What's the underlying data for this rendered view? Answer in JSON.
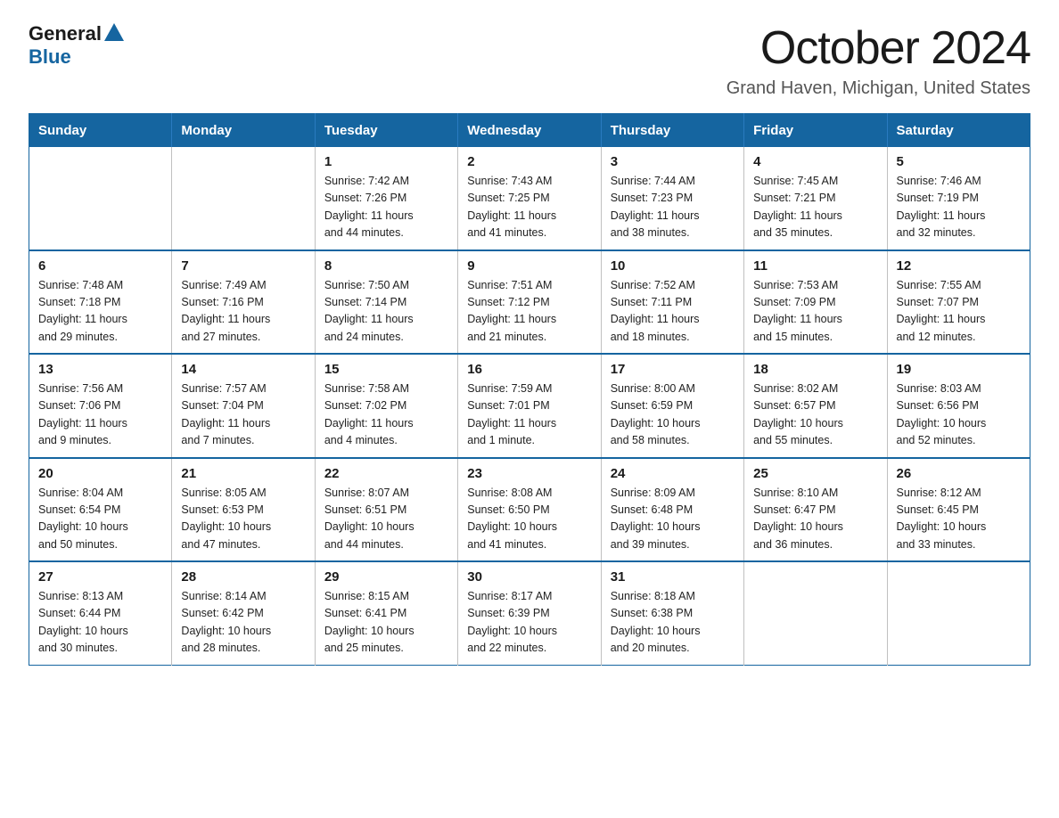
{
  "header": {
    "logo_general": "General",
    "logo_blue": "Blue",
    "title": "October 2024",
    "subtitle": "Grand Haven, Michigan, United States"
  },
  "days_of_week": [
    "Sunday",
    "Monday",
    "Tuesday",
    "Wednesday",
    "Thursday",
    "Friday",
    "Saturday"
  ],
  "weeks": [
    [
      {
        "day": "",
        "info": ""
      },
      {
        "day": "",
        "info": ""
      },
      {
        "day": "1",
        "info": "Sunrise: 7:42 AM\nSunset: 7:26 PM\nDaylight: 11 hours\nand 44 minutes."
      },
      {
        "day": "2",
        "info": "Sunrise: 7:43 AM\nSunset: 7:25 PM\nDaylight: 11 hours\nand 41 minutes."
      },
      {
        "day": "3",
        "info": "Sunrise: 7:44 AM\nSunset: 7:23 PM\nDaylight: 11 hours\nand 38 minutes."
      },
      {
        "day": "4",
        "info": "Sunrise: 7:45 AM\nSunset: 7:21 PM\nDaylight: 11 hours\nand 35 minutes."
      },
      {
        "day": "5",
        "info": "Sunrise: 7:46 AM\nSunset: 7:19 PM\nDaylight: 11 hours\nand 32 minutes."
      }
    ],
    [
      {
        "day": "6",
        "info": "Sunrise: 7:48 AM\nSunset: 7:18 PM\nDaylight: 11 hours\nand 29 minutes."
      },
      {
        "day": "7",
        "info": "Sunrise: 7:49 AM\nSunset: 7:16 PM\nDaylight: 11 hours\nand 27 minutes."
      },
      {
        "day": "8",
        "info": "Sunrise: 7:50 AM\nSunset: 7:14 PM\nDaylight: 11 hours\nand 24 minutes."
      },
      {
        "day": "9",
        "info": "Sunrise: 7:51 AM\nSunset: 7:12 PM\nDaylight: 11 hours\nand 21 minutes."
      },
      {
        "day": "10",
        "info": "Sunrise: 7:52 AM\nSunset: 7:11 PM\nDaylight: 11 hours\nand 18 minutes."
      },
      {
        "day": "11",
        "info": "Sunrise: 7:53 AM\nSunset: 7:09 PM\nDaylight: 11 hours\nand 15 minutes."
      },
      {
        "day": "12",
        "info": "Sunrise: 7:55 AM\nSunset: 7:07 PM\nDaylight: 11 hours\nand 12 minutes."
      }
    ],
    [
      {
        "day": "13",
        "info": "Sunrise: 7:56 AM\nSunset: 7:06 PM\nDaylight: 11 hours\nand 9 minutes."
      },
      {
        "day": "14",
        "info": "Sunrise: 7:57 AM\nSunset: 7:04 PM\nDaylight: 11 hours\nand 7 minutes."
      },
      {
        "day": "15",
        "info": "Sunrise: 7:58 AM\nSunset: 7:02 PM\nDaylight: 11 hours\nand 4 minutes."
      },
      {
        "day": "16",
        "info": "Sunrise: 7:59 AM\nSunset: 7:01 PM\nDaylight: 11 hours\nand 1 minute."
      },
      {
        "day": "17",
        "info": "Sunrise: 8:00 AM\nSunset: 6:59 PM\nDaylight: 10 hours\nand 58 minutes."
      },
      {
        "day": "18",
        "info": "Sunrise: 8:02 AM\nSunset: 6:57 PM\nDaylight: 10 hours\nand 55 minutes."
      },
      {
        "day": "19",
        "info": "Sunrise: 8:03 AM\nSunset: 6:56 PM\nDaylight: 10 hours\nand 52 minutes."
      }
    ],
    [
      {
        "day": "20",
        "info": "Sunrise: 8:04 AM\nSunset: 6:54 PM\nDaylight: 10 hours\nand 50 minutes."
      },
      {
        "day": "21",
        "info": "Sunrise: 8:05 AM\nSunset: 6:53 PM\nDaylight: 10 hours\nand 47 minutes."
      },
      {
        "day": "22",
        "info": "Sunrise: 8:07 AM\nSunset: 6:51 PM\nDaylight: 10 hours\nand 44 minutes."
      },
      {
        "day": "23",
        "info": "Sunrise: 8:08 AM\nSunset: 6:50 PM\nDaylight: 10 hours\nand 41 minutes."
      },
      {
        "day": "24",
        "info": "Sunrise: 8:09 AM\nSunset: 6:48 PM\nDaylight: 10 hours\nand 39 minutes."
      },
      {
        "day": "25",
        "info": "Sunrise: 8:10 AM\nSunset: 6:47 PM\nDaylight: 10 hours\nand 36 minutes."
      },
      {
        "day": "26",
        "info": "Sunrise: 8:12 AM\nSunset: 6:45 PM\nDaylight: 10 hours\nand 33 minutes."
      }
    ],
    [
      {
        "day": "27",
        "info": "Sunrise: 8:13 AM\nSunset: 6:44 PM\nDaylight: 10 hours\nand 30 minutes."
      },
      {
        "day": "28",
        "info": "Sunrise: 8:14 AM\nSunset: 6:42 PM\nDaylight: 10 hours\nand 28 minutes."
      },
      {
        "day": "29",
        "info": "Sunrise: 8:15 AM\nSunset: 6:41 PM\nDaylight: 10 hours\nand 25 minutes."
      },
      {
        "day": "30",
        "info": "Sunrise: 8:17 AM\nSunset: 6:39 PM\nDaylight: 10 hours\nand 22 minutes."
      },
      {
        "day": "31",
        "info": "Sunrise: 8:18 AM\nSunset: 6:38 PM\nDaylight: 10 hours\nand 20 minutes."
      },
      {
        "day": "",
        "info": ""
      },
      {
        "day": "",
        "info": ""
      }
    ]
  ]
}
